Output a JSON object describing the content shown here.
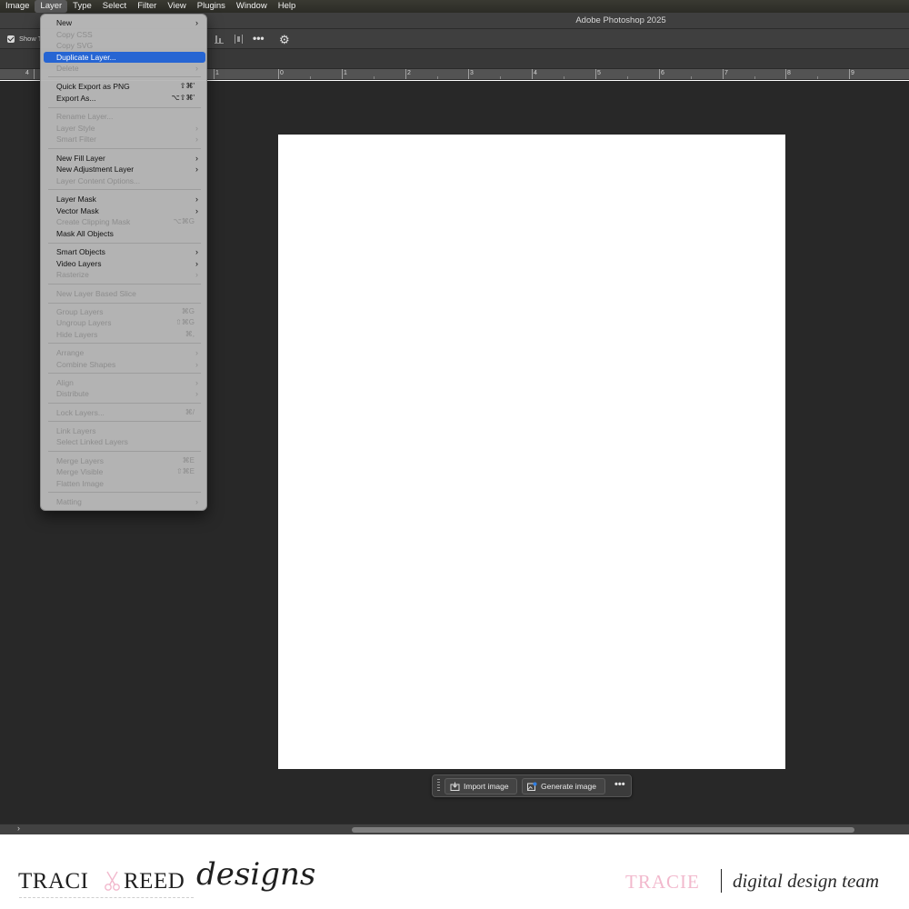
{
  "menubar": {
    "items": [
      {
        "label": "Image"
      },
      {
        "label": "Layer",
        "active": true
      },
      {
        "label": "Type"
      },
      {
        "label": "Select"
      },
      {
        "label": "Filter"
      },
      {
        "label": "View"
      },
      {
        "label": "Plugins"
      },
      {
        "label": "Window"
      },
      {
        "label": "Help"
      }
    ]
  },
  "window": {
    "title": "Adobe Photoshop 2025"
  },
  "options_bar": {
    "show_label": "Show T",
    "more_icon": "more-horizontal-icon",
    "settings_icon": "gear-icon"
  },
  "ruler": {
    "labels": [
      "4",
      "1",
      "0",
      "1",
      "2",
      "3",
      "4",
      "5",
      "6",
      "7",
      "8",
      "9"
    ]
  },
  "layer_menu": {
    "items": [
      {
        "label": "New",
        "enabled": true,
        "submenu": true
      },
      {
        "label": "Copy CSS",
        "enabled": false
      },
      {
        "label": "Copy SVG",
        "enabled": false
      },
      {
        "label": "Duplicate Layer...",
        "enabled": true,
        "highlighted": true
      },
      {
        "label": "Delete",
        "enabled": false,
        "submenu": true
      },
      {
        "label": "Quick Export as PNG",
        "enabled": true,
        "shortcut": "⇧⌘'"
      },
      {
        "label": "Export As...",
        "enabled": true,
        "shortcut": "⌥⇧⌘'"
      },
      {
        "label": "Rename Layer...",
        "enabled": false
      },
      {
        "label": "Layer Style",
        "enabled": false,
        "submenu": true
      },
      {
        "label": "Smart Filter",
        "enabled": false,
        "submenu": true
      },
      {
        "label": "New Fill Layer",
        "enabled": true,
        "submenu": true
      },
      {
        "label": "New Adjustment Layer",
        "enabled": true,
        "submenu": true
      },
      {
        "label": "Layer Content Options...",
        "enabled": false
      },
      {
        "label": "Layer Mask",
        "enabled": true,
        "submenu": true
      },
      {
        "label": "Vector Mask",
        "enabled": true,
        "submenu": true
      },
      {
        "label": "Create Clipping Mask",
        "enabled": false,
        "shortcut": "⌥⌘G"
      },
      {
        "label": "Mask All Objects",
        "enabled": true
      },
      {
        "label": "Smart Objects",
        "enabled": true,
        "submenu": true
      },
      {
        "label": "Video Layers",
        "enabled": true,
        "submenu": true
      },
      {
        "label": "Rasterize",
        "enabled": false,
        "submenu": true
      },
      {
        "label": "New Layer Based Slice",
        "enabled": false
      },
      {
        "label": "Group Layers",
        "enabled": false,
        "shortcut": "⌘G"
      },
      {
        "label": "Ungroup Layers",
        "enabled": false,
        "shortcut": "⇧⌘G"
      },
      {
        "label": "Hide Layers",
        "enabled": false,
        "shortcut": "⌘,"
      },
      {
        "label": "Arrange",
        "enabled": false,
        "submenu": true
      },
      {
        "label": "Combine Shapes",
        "enabled": false,
        "submenu": true
      },
      {
        "label": "Align",
        "enabled": false,
        "submenu": true
      },
      {
        "label": "Distribute",
        "enabled": false,
        "submenu": true
      },
      {
        "label": "Lock Layers...",
        "enabled": false,
        "shortcut": "⌘/"
      },
      {
        "label": "Link Layers",
        "enabled": false
      },
      {
        "label": "Select Linked Layers",
        "enabled": false
      },
      {
        "label": "Merge Layers",
        "enabled": false,
        "shortcut": "⌘E"
      },
      {
        "label": "Merge Visible",
        "enabled": false,
        "shortcut": "⇧⌘E"
      },
      {
        "label": "Flatten Image",
        "enabled": false
      },
      {
        "label": "Matting",
        "enabled": false,
        "submenu": true
      }
    ],
    "highlight_color": "#2665d3"
  },
  "taskbar": {
    "import_label": "Import image",
    "generate_label": "Generate image",
    "more_icon": "more-horizontal-icon"
  },
  "branding": {
    "logo_traci": "TRACI",
    "logo_reed": "REED",
    "logo_designs": "designs",
    "member_name": "TRACIE",
    "team_label": "digital design team",
    "member_color": "#f2b9cd"
  }
}
